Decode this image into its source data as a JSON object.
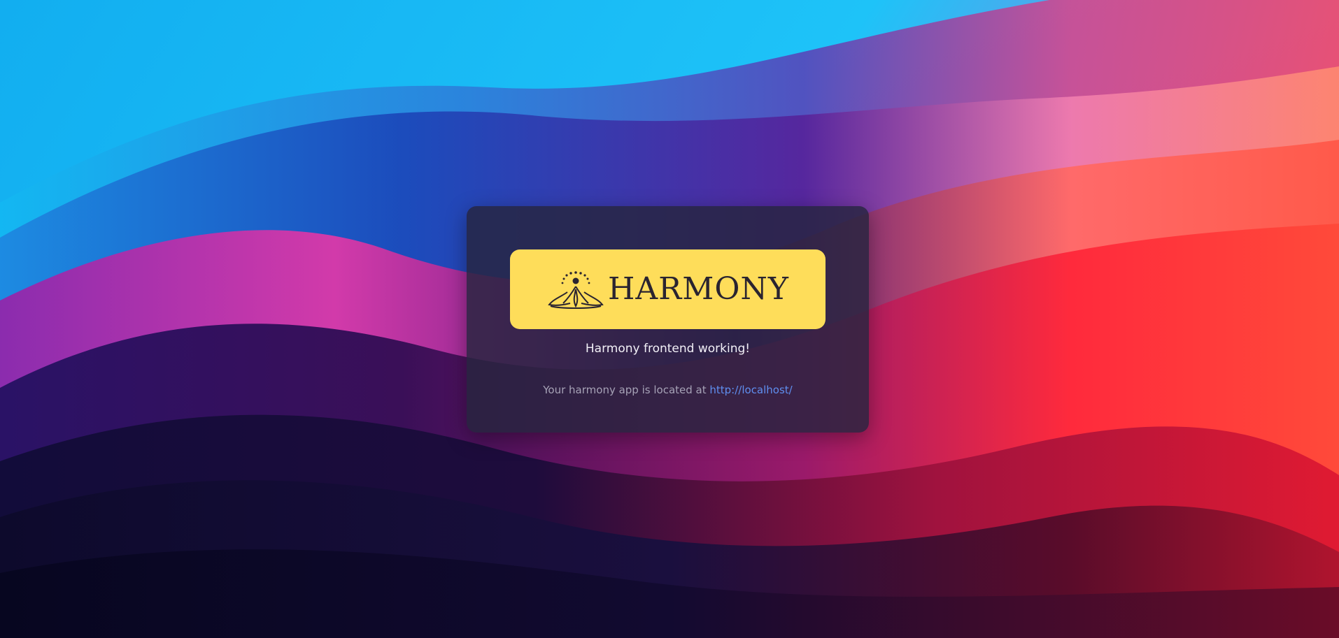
{
  "logo": {
    "text": "HARMONY",
    "background": "#fedd5a",
    "icon": "lotus-dots-icon"
  },
  "card": {
    "headline": "Harmony frontend working!",
    "location_prefix": "Your harmony app is located at",
    "location_link": "http://localhost/"
  },
  "colors": {
    "card_bg": "#26243e",
    "link": "#5f8ff0",
    "muted_text": "#a6a2b6",
    "headline_text": "#f2f0f7"
  }
}
